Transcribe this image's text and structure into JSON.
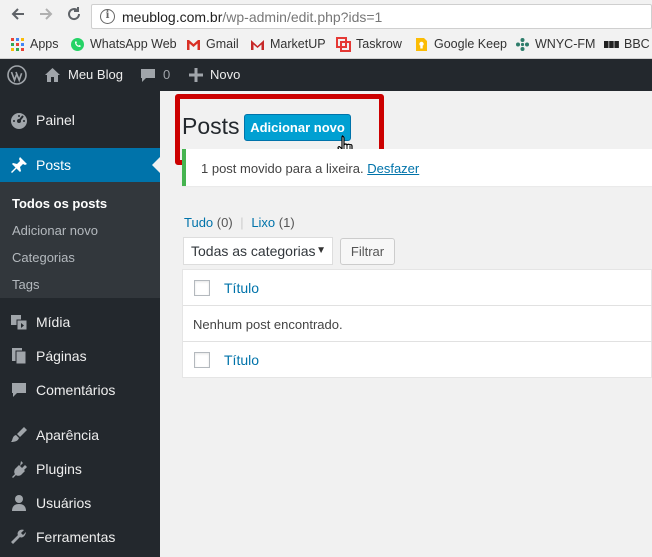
{
  "browser": {
    "url_host": "meublog.com.br",
    "url_path": "/wp-admin/edit.php?ids=1",
    "bookmarks": [
      {
        "label": "Apps",
        "icon": "apps-grid-icon"
      },
      {
        "label": "WhatsApp Web",
        "icon": "whatsapp-icon"
      },
      {
        "label": "Gmail",
        "icon": "gmail-icon"
      },
      {
        "label": "MarketUP",
        "icon": "marketup-icon"
      },
      {
        "label": "Taskrow",
        "icon": "taskrow-icon"
      },
      {
        "label": "Google Keep",
        "icon": "google-keep-icon"
      },
      {
        "label": "WNYC-FM",
        "icon": "wnyc-icon"
      },
      {
        "label": "BBC N",
        "icon": "bbc-icon"
      }
    ]
  },
  "adminbar": {
    "site_name": "Meu Blog",
    "comments_count": "0",
    "new_label": "Novo"
  },
  "sidebar": {
    "items": [
      {
        "label": "Painel",
        "icon": "dashboard-icon"
      },
      {
        "label": "Posts",
        "icon": "pin-icon"
      },
      {
        "label": "Mídia",
        "icon": "media-icon"
      },
      {
        "label": "Páginas",
        "icon": "pages-icon"
      },
      {
        "label": "Comentários",
        "icon": "comment-icon"
      },
      {
        "label": "Aparência",
        "icon": "appearance-icon"
      },
      {
        "label": "Plugins",
        "icon": "plugins-icon"
      },
      {
        "label": "Usuários",
        "icon": "users-icon"
      },
      {
        "label": "Ferramentas",
        "icon": "tools-icon"
      }
    ],
    "submenu": [
      "Todos os posts",
      "Adicionar novo",
      "Categorias",
      "Tags"
    ]
  },
  "main": {
    "title": "Posts",
    "add_new_label": "Adicionar novo",
    "notice_text": "1 post movido para a lixeira.",
    "notice_link": "Desfazer",
    "views": {
      "all_label": "Tudo",
      "all_count": "(0)",
      "trash_label": "Lixo",
      "trash_count": "(1)"
    },
    "category_select": "Todas as categorias",
    "filter_label": "Filtrar",
    "table": {
      "header_title": "Título",
      "empty_message": "Nenhum post encontrado.",
      "footer_title": "Título"
    }
  },
  "colors": {
    "admin_dark": "#23282d",
    "active_blue": "#0073aa",
    "button_blue": "#00a0d2",
    "notice_green": "#46b450",
    "highlight_red": "#cc0000"
  }
}
